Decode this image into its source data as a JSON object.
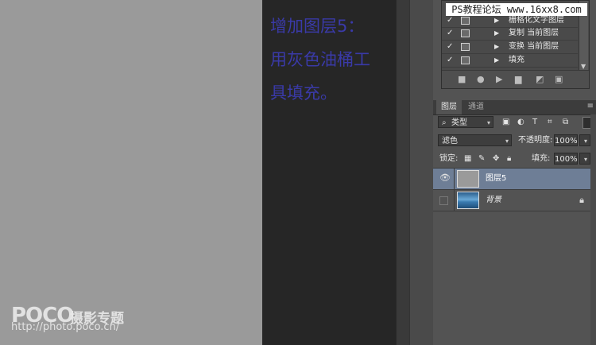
{
  "watermarks": {
    "logo": "POCO",
    "tagline": "摄影专题",
    "url": "http://photo.poco.cn/",
    "top_banner": "PS教程论坛 www.16xx8.com"
  },
  "instruction": {
    "line1": "增加图层5：",
    "line2": "用灰色油桶工",
    "line3": "具填充。",
    "color": "#3a3aa8"
  },
  "history": {
    "items": [
      {
        "label": "栅格化文字图层",
        "checked": true
      },
      {
        "label": "复制 当前图层",
        "checked": true
      },
      {
        "label": "变换 当前图层",
        "checked": true
      },
      {
        "label": "填充",
        "checked": true
      }
    ]
  },
  "layers_panel": {
    "tabs": [
      "图层",
      "通道"
    ],
    "filter_kind": "类型",
    "blend_mode": "滤色",
    "opacity_label": "不透明度:",
    "opacity_value": "100%",
    "lock_label": "锁定:",
    "fill_label": "填充:",
    "fill_value": "100%",
    "layers": [
      {
        "name": "图层5",
        "visible": true,
        "selected": true,
        "thumb_color": "#9a9a9a"
      },
      {
        "name": "背景",
        "visible": false,
        "selected": false,
        "locked": true,
        "thumb_color": "#4a8ab8"
      }
    ]
  },
  "icons": {
    "eye": "eye-icon",
    "lock": "lock-icon",
    "search": "search-icon",
    "menu": "panel-menu-icon"
  }
}
